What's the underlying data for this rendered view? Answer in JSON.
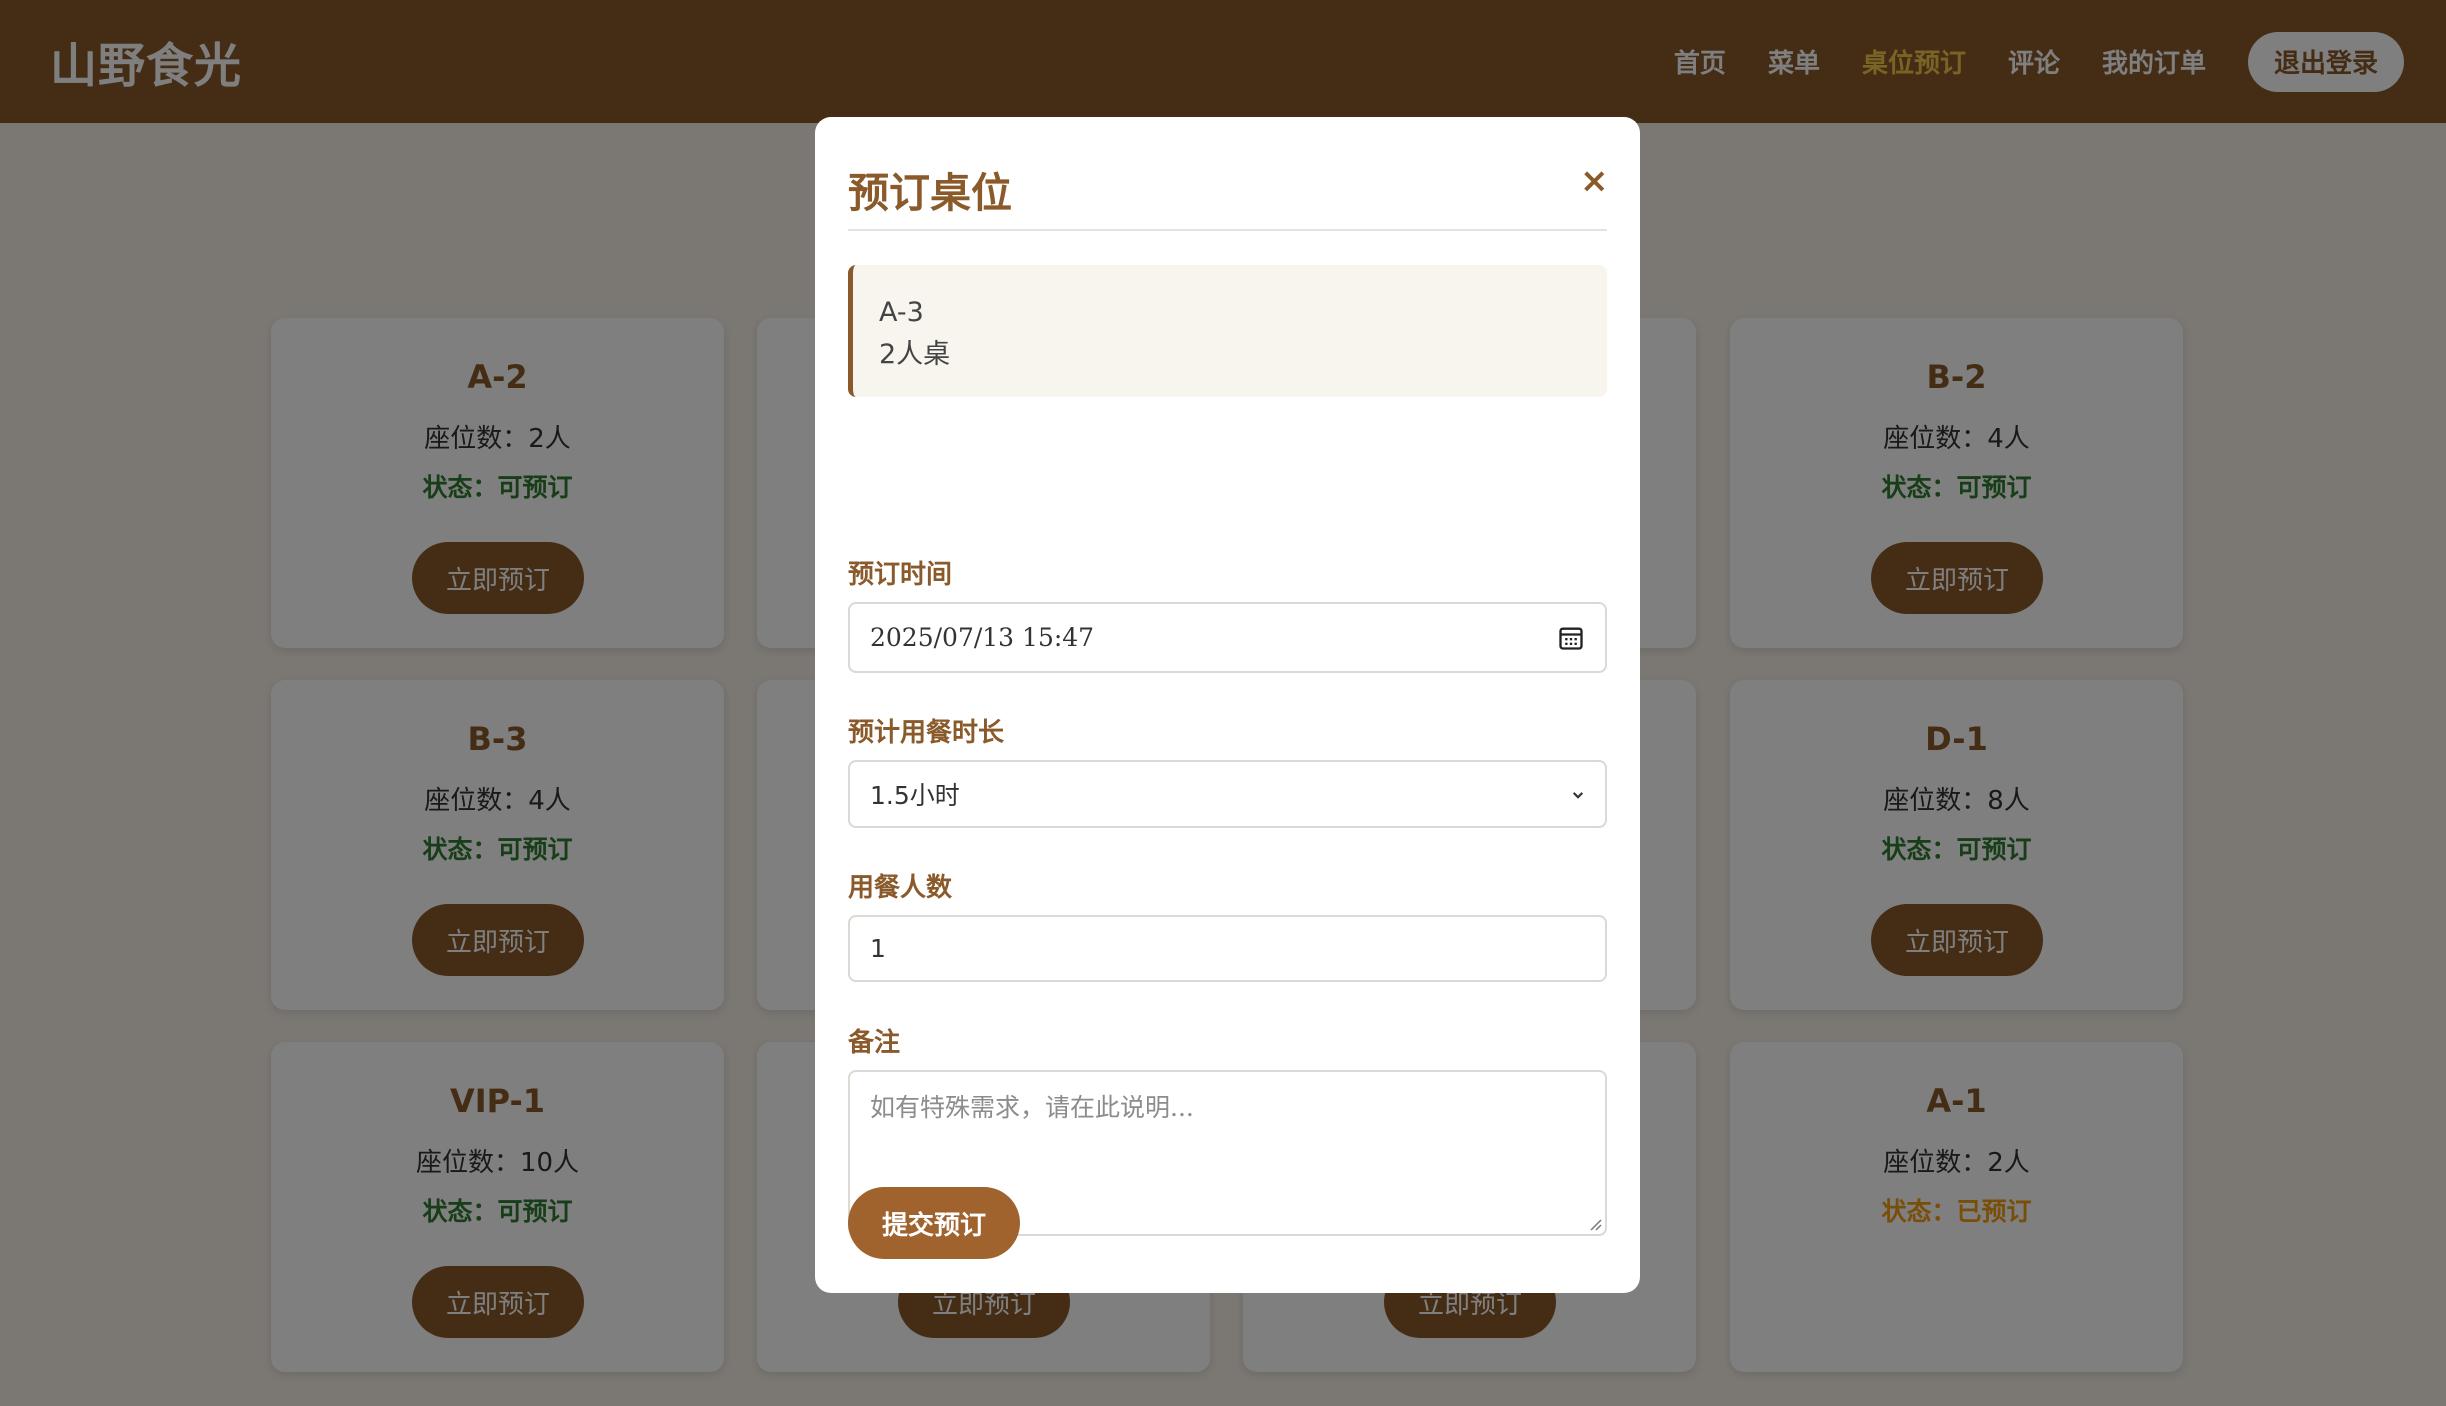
{
  "header": {
    "logo": "山野食光",
    "nav": [
      "首页",
      "菜单",
      "桌位预订",
      "评论",
      "我的订单"
    ],
    "active_nav": "桌位预订",
    "logout_label": "退出登录"
  },
  "tables": [
    {
      "name": "A-2",
      "seats": "座位数：2人",
      "status": "状态：可预订",
      "button": "立即预订"
    },
    {
      "name": "B-2",
      "seats": "座位数：4人",
      "status": "状态：可预订",
      "button": "立即预订"
    },
    {
      "name": "B-3",
      "seats": "座位数：4人",
      "status": "状态：可预订",
      "button": "立即预订"
    },
    {
      "name": "D-1",
      "seats": "座位数：8人",
      "status": "状态：可预订",
      "button": "立即预订"
    },
    {
      "name": "VIP-1",
      "seats": "座位数：10人",
      "status": "状态：可预订",
      "button": "立即预订"
    },
    {
      "name": "A-1",
      "seats": "座位数：2人",
      "status": "状态：已预订"
    },
    {
      "button": "立即预订"
    },
    {
      "button": "立即预订"
    }
  ],
  "modal": {
    "title": "预订桌位",
    "close_symbol": "×",
    "table_info": {
      "name": "A-3",
      "type": "2人桌"
    },
    "time_label": "预订时间",
    "time_value": "2025/07/13  15:47",
    "duration_label": "预计用餐时长",
    "duration_value": "1.5小时",
    "guests_label": "用餐人数",
    "guests_value": "1",
    "notes_label": "备注",
    "notes_placeholder": "如有特殊需求，请在此说明...",
    "submit_label": "提交预订"
  },
  "colors": {
    "brand_brown": "#8a5a2b",
    "active_nav": "#f2c94c",
    "available_green": "#2e7d32",
    "booked_orange": "#f39c12"
  },
  "icons": [
    "calendar-icon",
    "chevron-down-icon",
    "close-icon",
    "resize-grip-icon"
  ]
}
